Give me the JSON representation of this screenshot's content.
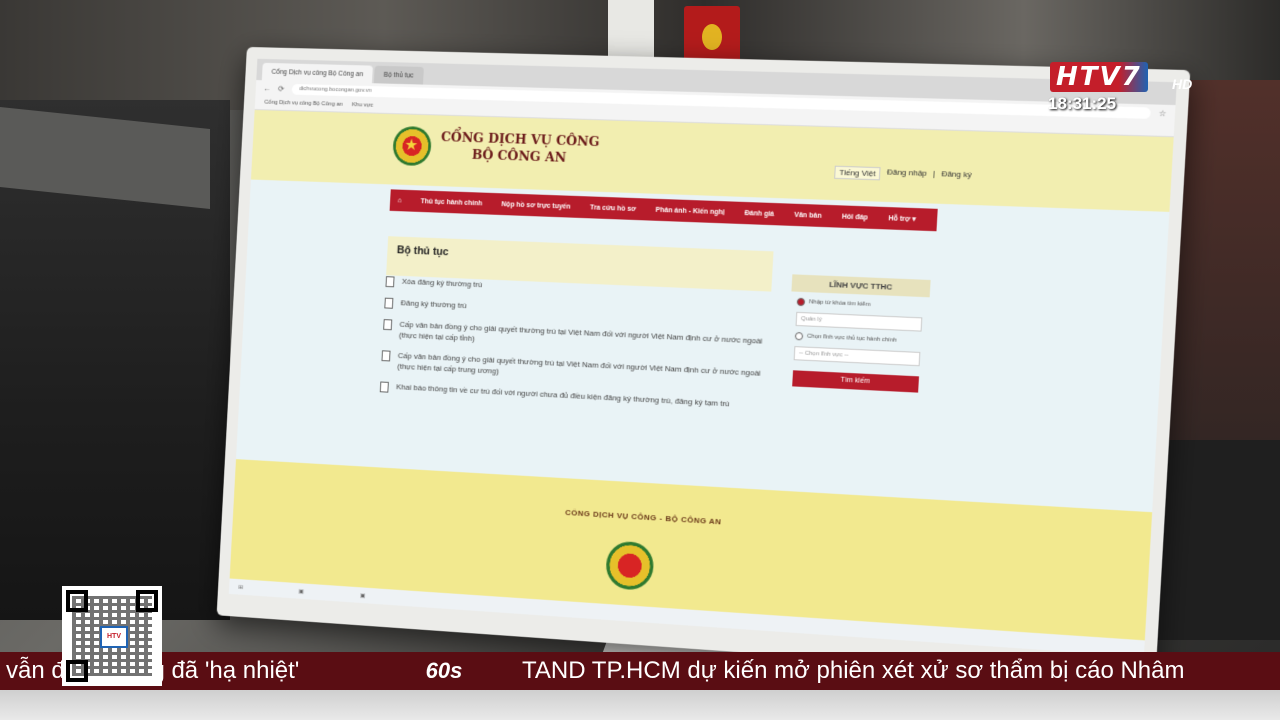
{
  "browser": {
    "tabs": [
      "Cổng Dịch vụ công Bộ Công an",
      "Bộ thủ tục"
    ],
    "address": "dichvucong.bocongan.gov.vn",
    "bookmarks": [
      "Cổng Dịch vụ công Bộ Công an",
      "Khu vực"
    ]
  },
  "site": {
    "title_line1": "CỔNG DỊCH VỤ CÔNG",
    "title_line2": "BỘ CÔNG AN",
    "language": "Tiếng Việt",
    "login": "Đăng nhập",
    "register": "Đăng ký",
    "login_sep": "|"
  },
  "nav": {
    "home_icon": "home-icon",
    "items": [
      "Thủ tục hành chính",
      "Nộp hồ sơ trực tuyến",
      "Tra cứu hồ sơ",
      "Phản ánh - Kiến nghị",
      "Đánh giá",
      "Văn bản",
      "Hỏi đáp",
      "Hỗ trợ ▾"
    ]
  },
  "main": {
    "title": "Bộ thủ tục",
    "procedures": [
      "Xóa đăng ký thường trú",
      "Đăng ký thường trú",
      "Cấp văn bản đồng ý cho giải quyết thường trú tại Việt Nam đối với người Việt Nam định cư ở nước ngoài (thực hiện tại cấp tỉnh)",
      "Cấp văn bản đồng ý cho giải quyết thường trú tại Việt Nam đối với người Việt Nam định cư ở nước ngoài (thực hiện tại cấp trung ương)",
      "Khai báo thông tin về cư trú đối với người chưa đủ điều kiện đăng ký thường trú, đăng ký tạm trú"
    ]
  },
  "sidebar": {
    "heading": "LĨNH VỰC TTHC",
    "option1": "Nhập từ khóa tìm kiếm",
    "keyword_value": "Quản lý",
    "option2": "Chọn lĩnh vực thủ tục hành chính",
    "select_placeholder": "-- Chọn lĩnh vực --",
    "search_label": "Tìm kiếm"
  },
  "footer": {
    "text": "CỔNG DỊCH VỤ CÔNG - BỘ CÔNG AN"
  },
  "broadcast": {
    "channel": "HTV7",
    "hd": "HD",
    "time": "18:31:25",
    "ticker_left": "vẫn đang ... ng đã 'hạ nhiệt'",
    "ticker_logo": "60s",
    "ticker_right": "TAND TP.HCM dự kiến mở phiên xét xử sơ thẩm bị cáo Nhâm"
  },
  "colors": {
    "nav_red": "#b71c2b",
    "header_yellow": "#f2eeb0",
    "ticker_bg": "#5a0d13"
  }
}
